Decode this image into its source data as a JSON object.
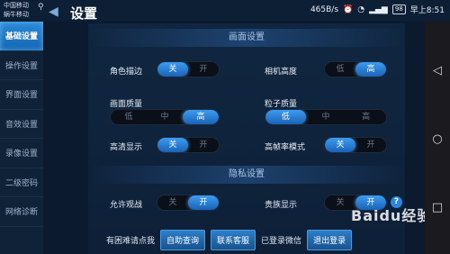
{
  "statusbar": {
    "carrier_line1": "中国移动",
    "carrier_line2": "蜗牛移动",
    "speed": "465B/s",
    "battery": "98",
    "time": "早上8:51"
  },
  "header": {
    "title": "设置",
    "back_icon": "back-arrow-icon"
  },
  "sidebar": {
    "items": [
      {
        "label": "基础设置",
        "active": true
      },
      {
        "label": "操作设置",
        "active": false
      },
      {
        "label": "界面设置",
        "active": false
      },
      {
        "label": "音效设置",
        "active": false
      },
      {
        "label": "录像设置",
        "active": false
      },
      {
        "label": "二级密码",
        "active": false
      },
      {
        "label": "网络诊断",
        "active": false
      }
    ]
  },
  "graphics": {
    "header": "画面设置",
    "edge": {
      "label": "角色描边",
      "options": [
        "关",
        "开"
      ],
      "selected": 0
    },
    "cam_height": {
      "label": "相机高度",
      "options": [
        "低",
        "高"
      ],
      "selected": 1
    },
    "quality": {
      "label": "画面质量",
      "options": [
        "低",
        "中",
        "高"
      ],
      "selected": 2
    },
    "particles": {
      "label": "粒子质量",
      "options": [
        "低",
        "中",
        "高"
      ],
      "selected": 0
    },
    "hd": {
      "label": "高清显示",
      "options": [
        "关",
        "开"
      ],
      "selected": 0
    },
    "hfr": {
      "label": "高帧率模式",
      "options": [
        "关",
        "开"
      ],
      "selected": 0
    }
  },
  "privacy": {
    "header": "隐私设置",
    "spectate": {
      "label": "允许观战",
      "options": [
        "关",
        "开"
      ],
      "selected": 1
    },
    "noble": {
      "label": "贵族显示",
      "options": [
        "关",
        "开"
      ],
      "selected": 1
    }
  },
  "bottom": {
    "help_text": "有困难请点我",
    "self_query": "自助查询",
    "contact_service": "联系客服",
    "logged_wechat": "已登录微信",
    "logout": "退出登录"
  },
  "watermark": "Baidu经验",
  "colors": {
    "accent": "#2b8ee0",
    "bg": "#0b1a2e"
  }
}
